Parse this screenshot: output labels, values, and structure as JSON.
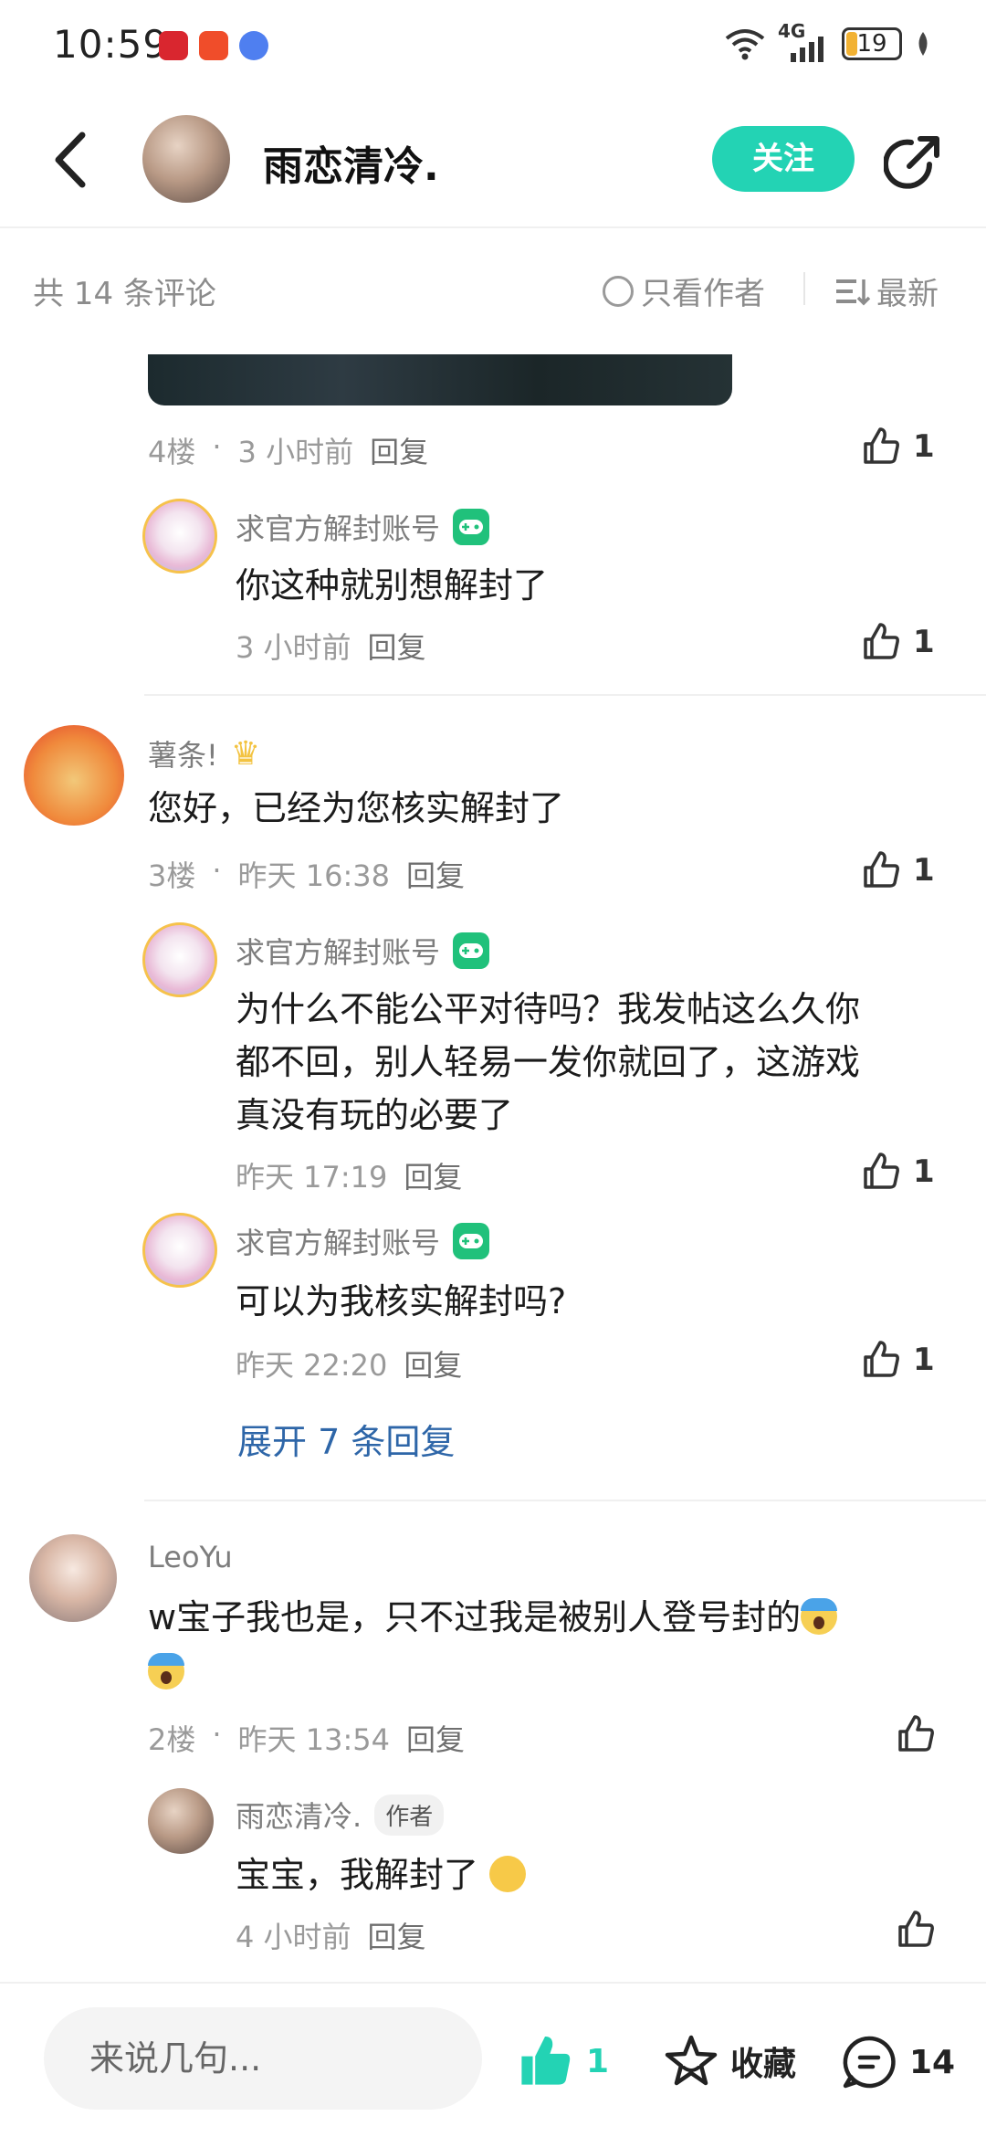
{
  "status_bar": {
    "time": "10:59",
    "network": "4G",
    "battery": "19"
  },
  "header": {
    "username": "雨恋清冷.",
    "follow_label": "关注"
  },
  "filter": {
    "comment_count": "共 14 条评论",
    "author_only": "只看作者",
    "sort": "最新"
  },
  "comments": {
    "c4": {
      "floor": "4楼",
      "time": "3 小时前",
      "reply_label": "回复",
      "likes": "1"
    },
    "c4_reply1": {
      "user": "求官方解封账号",
      "text": "你这种就别想解封了",
      "time": "3 小时前",
      "reply_label": "回复",
      "likes": "1"
    },
    "c3": {
      "user": "薯条!",
      "text": "您好，已经为您核实解封了",
      "floor": "3楼",
      "time": "昨天 16:38",
      "reply_label": "回复",
      "likes": "1"
    },
    "c3_reply1": {
      "user": "求官方解封账号",
      "text_line1": "为什么不能公平对待吗？我发帖这么久你",
      "text_line2": "都不回，别人轻易一发你就回了，这游戏",
      "text_line3": "真没有玩的必要了",
      "time": "昨天 17:19",
      "reply_label": "回复",
      "likes": "1"
    },
    "c3_reply2": {
      "user": "求官方解封账号",
      "text": "可以为我核实解封吗?",
      "time": "昨天 22:20",
      "reply_label": "回复",
      "likes": "1"
    },
    "c3_expand": "展开 7 条回复",
    "c2": {
      "user": "LeoYu",
      "text": "w宝子我也是，只不过我是被别人登号封的",
      "floor": "2楼",
      "time": "昨天 13:54",
      "reply_label": "回复"
    },
    "c2_reply1": {
      "user": "雨恋清冷.",
      "author_tag": "作者",
      "text": "宝宝，我解封了",
      "time": "4 小时前",
      "reply_label": "回复"
    }
  },
  "bottom_bar": {
    "input_placeholder": "来说几句...",
    "like_count": "1",
    "favorite_label": "收藏",
    "comment_count": "14"
  },
  "colors": {
    "accent": "#23d3b4",
    "link": "#2e66a8",
    "game_badge": "#20c17b"
  }
}
